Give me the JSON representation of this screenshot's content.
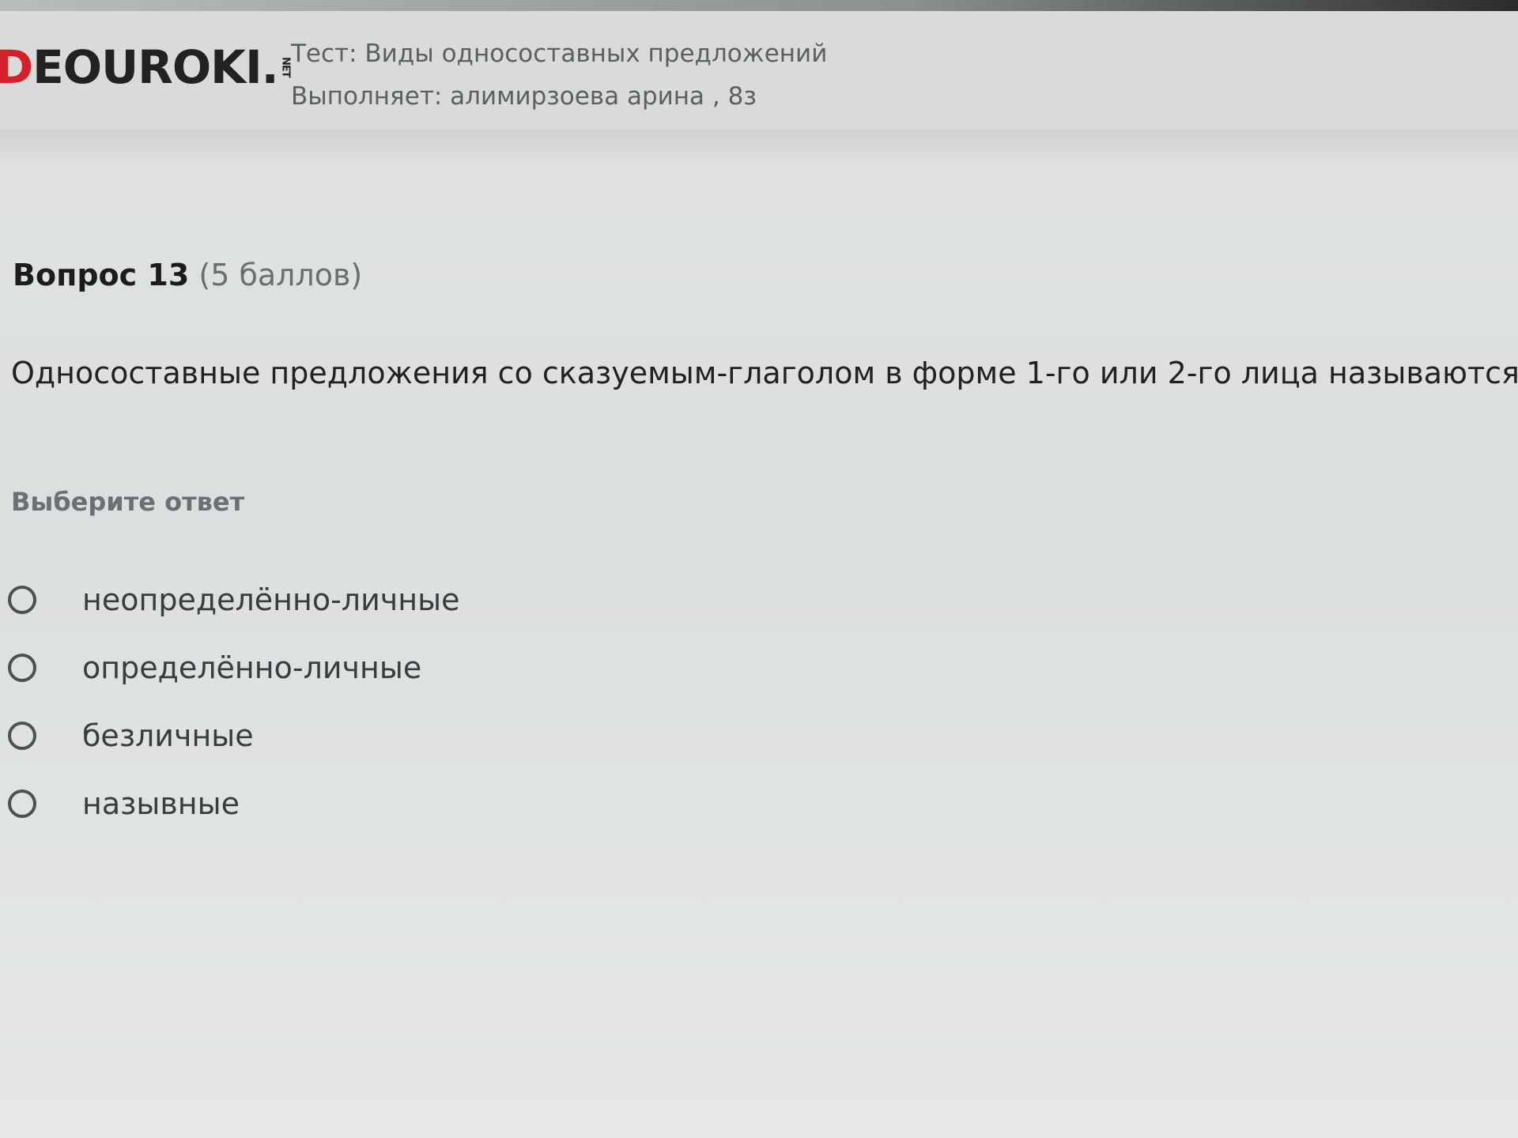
{
  "header": {
    "logo": {
      "prefix": "D",
      "main": "EOUROKI",
      "dot": ".",
      "tld": "NET"
    },
    "test_title": "Тест: Виды односоставных предложений",
    "performer": "Выполняет: алимирзоева арина , 8з"
  },
  "question": {
    "label": "Вопрос 13",
    "points": "(5 баллов)",
    "text": "Односоставные предложения со сказуемым-глаголом в форме 1-го или 2-го лица называются..."
  },
  "answer_prompt": "Выберите ответ",
  "options": [
    {
      "label": "неопределённо-личные",
      "selected": false
    },
    {
      "label": "определённо-личные",
      "selected": false
    },
    {
      "label": "безличные",
      "selected": false
    },
    {
      "label": "назывные",
      "selected": false
    }
  ],
  "colors": {
    "logo_accent": "#d51f2b",
    "background": "#dcdfdf",
    "text_dark": "#1d1f20",
    "text_muted": "#6a6e70"
  }
}
